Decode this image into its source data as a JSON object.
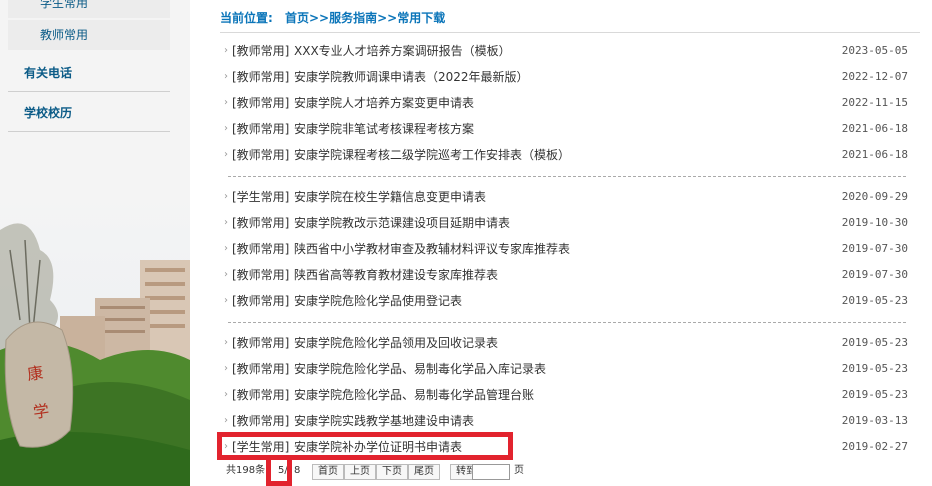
{
  "sidebar": {
    "sub_items": [
      {
        "label": "学生常用"
      },
      {
        "label": "教师常用"
      }
    ],
    "nav_items": [
      {
        "label": "有关电话"
      },
      {
        "label": "学校校历"
      }
    ]
  },
  "breadcrumb": {
    "prefix": "当前位置:",
    "path": "首页>>服务指南>>常用下载"
  },
  "list": [
    {
      "category": "[教师常用]",
      "title": "XXX专业人才培养方案调研报告（模板）",
      "date": "2023-05-05"
    },
    {
      "category": "[教师常用]",
      "title": "安康学院教师调课申请表（2022年最新版）",
      "date": "2022-12-07"
    },
    {
      "category": "[教师常用]",
      "title": "安康学院人才培养方案变更申请表",
      "date": "2022-11-15"
    },
    {
      "category": "[教师常用]",
      "title": "安康学院非笔试考核课程考核方案",
      "date": "2021-06-18"
    },
    {
      "category": "[教师常用]",
      "title": "安康学院课程考核二级学院巡考工作安排表（模板）",
      "date": "2021-06-18"
    },
    {
      "category": "[学生常用]",
      "title": "安康学院在校生学籍信息变更申请表",
      "date": "2020-09-29"
    },
    {
      "category": "[教师常用]",
      "title": "安康学院教改示范课建设项目延期申请表",
      "date": "2019-10-30"
    },
    {
      "category": "[教师常用]",
      "title": "陕西省中小学教材审查及教辅材料评议专家库推荐表",
      "date": "2019-07-30"
    },
    {
      "category": "[教师常用]",
      "title": "陕西省高等教育教材建设专家库推荐表",
      "date": "2019-07-30"
    },
    {
      "category": "[教师常用]",
      "title": "安康学院危险化学品使用登记表",
      "date": "2019-05-23"
    },
    {
      "category": "[教师常用]",
      "title": "安康学院危险化学品领用及回收记录表",
      "date": "2019-05-23"
    },
    {
      "category": "[教师常用]",
      "title": "安康学院危险化学品、易制毒化学品入库记录表",
      "date": "2019-05-23"
    },
    {
      "category": "[教师常用]",
      "title": "安康学院危险化学品、易制毒化学品管理台账",
      "date": "2019-05-23"
    },
    {
      "category": "[教师常用]",
      "title": "安康学院实践教学基地建设申请表",
      "date": "2019-03-13"
    },
    {
      "category": "[学生常用]",
      "title": "安康学院补办学位证明书申请表",
      "date": "2019-02-27"
    }
  ],
  "pager": {
    "total": "共198条",
    "page_indicator": "5/",
    "page_suffix": "8",
    "first": "首页",
    "prev": "上页",
    "next": "下页",
    "last": "尾页",
    "goto": "转到",
    "page_unit": "页"
  },
  "colors": {
    "link": "#0b75b9",
    "sidebar_text": "#0b5b87",
    "highlight": "#e2232e"
  },
  "icons": {
    "row_marker": "chevron-right-icon"
  }
}
